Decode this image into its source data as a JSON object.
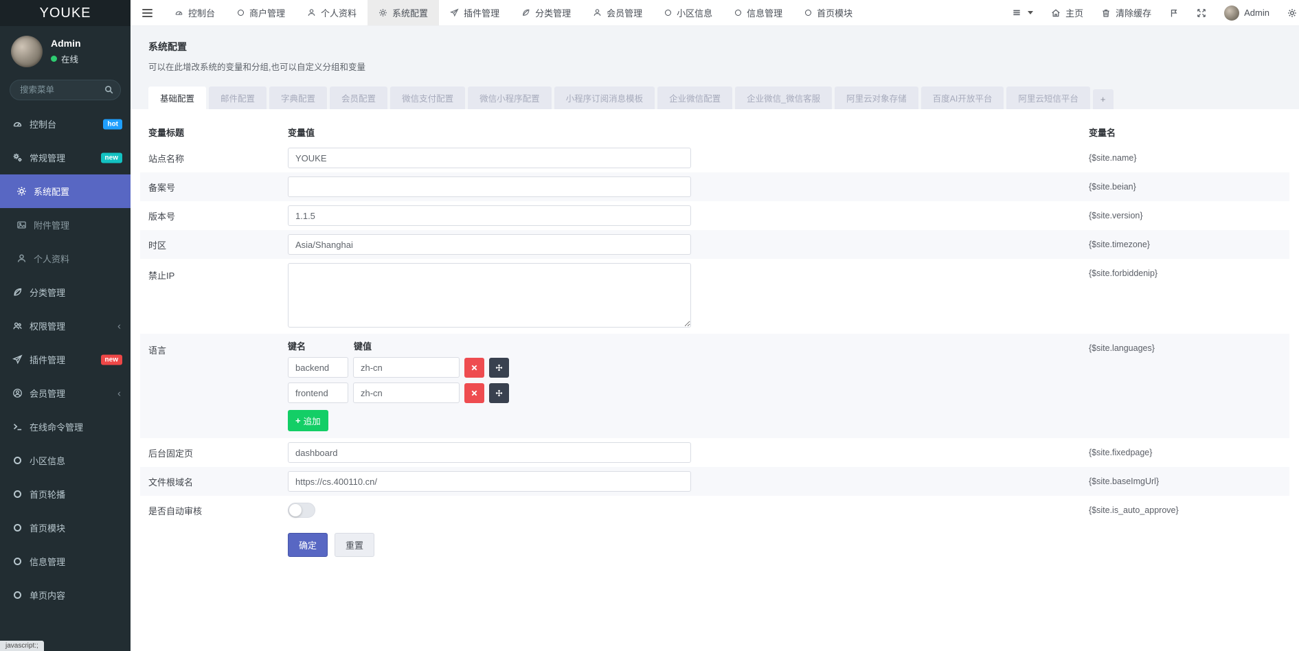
{
  "app": {
    "logo": "YOUKE"
  },
  "sidebar": {
    "user": {
      "name": "Admin",
      "status": "在线"
    },
    "search_placeholder": "搜索菜单",
    "items": [
      {
        "label": "控制台",
        "badge": "hot"
      },
      {
        "label": "常规管理",
        "badge": "new"
      },
      {
        "label": "系统配置"
      },
      {
        "label": "附件管理"
      },
      {
        "label": "个人资料"
      },
      {
        "label": "分类管理"
      },
      {
        "label": "权限管理",
        "arrow": "‹"
      },
      {
        "label": "插件管理",
        "badge": "new"
      },
      {
        "label": "会员管理",
        "arrow": "‹"
      },
      {
        "label": "在线命令管理"
      },
      {
        "label": "小区信息"
      },
      {
        "label": "首页轮播"
      },
      {
        "label": "首页模块"
      },
      {
        "label": "信息管理"
      },
      {
        "label": "单页内容"
      }
    ],
    "status_bar": "javascript:;"
  },
  "topnav": {
    "items": [
      {
        "label": "控制台"
      },
      {
        "label": "商户管理"
      },
      {
        "label": "个人资料"
      },
      {
        "label": "系统配置"
      },
      {
        "label": "插件管理"
      },
      {
        "label": "分类管理"
      },
      {
        "label": "会员管理"
      },
      {
        "label": "小区信息"
      },
      {
        "label": "信息管理"
      },
      {
        "label": "首页模块"
      }
    ],
    "home": "主页",
    "clear_cache": "清除缓存",
    "admin": "Admin"
  },
  "page": {
    "title": "系统配置",
    "subtitle": "可以在此增改系统的变量和分组,也可以自定义分组和变量"
  },
  "tabs": {
    "items": [
      "基础配置",
      "邮件配置",
      "字典配置",
      "会员配置",
      "微信支付配置",
      "微信小程序配置",
      "小程序订阅消息模板",
      "企业微信配置",
      "企业微信_微信客服",
      "阿里云对象存储",
      "百度AI开放平台",
      "阿里云短信平台"
    ],
    "add": "+"
  },
  "form": {
    "col_title": "变量标题",
    "col_value": "变量值",
    "col_name": "变量名",
    "rows": [
      {
        "label": "站点名称",
        "value": "YOUKE",
        "var": "{$site.name}"
      },
      {
        "label": "备案号",
        "value": "",
        "var": "{$site.beian}"
      },
      {
        "label": "版本号",
        "value": "1.1.5",
        "var": "{$site.version}"
      },
      {
        "label": "时区",
        "value": "Asia/Shanghai",
        "var": "{$site.timezone}"
      },
      {
        "label": "禁止IP",
        "value": "",
        "var": "{$site.forbiddenip}"
      },
      {
        "label": "语言",
        "var": "{$site.languages}",
        "key_header": "键名",
        "value_header": "键值",
        "pairs": [
          {
            "key": "backend",
            "val": "zh-cn"
          },
          {
            "key": "frontend",
            "val": "zh-cn"
          }
        ],
        "append": "追加"
      },
      {
        "label": "后台固定页",
        "value": "dashboard",
        "var": "{$site.fixedpage}"
      },
      {
        "label": "文件根域名",
        "value": "https://cs.400110.cn/",
        "var": "{$site.baseImgUrl}"
      },
      {
        "label": "是否自动审核",
        "var": "{$site.is_auto_approve}",
        "toggle_state": "off"
      }
    ],
    "submit": "确定",
    "reset": "重置"
  },
  "colors": {
    "accent": "#5867c3",
    "badge_hot": "#1e9fff",
    "badge_new_teal": "#13c2c2",
    "badge_new_red": "#ee4747",
    "append_green": "#13ce66",
    "delete_red": "#ee4c50",
    "move_dark": "#39414f"
  }
}
